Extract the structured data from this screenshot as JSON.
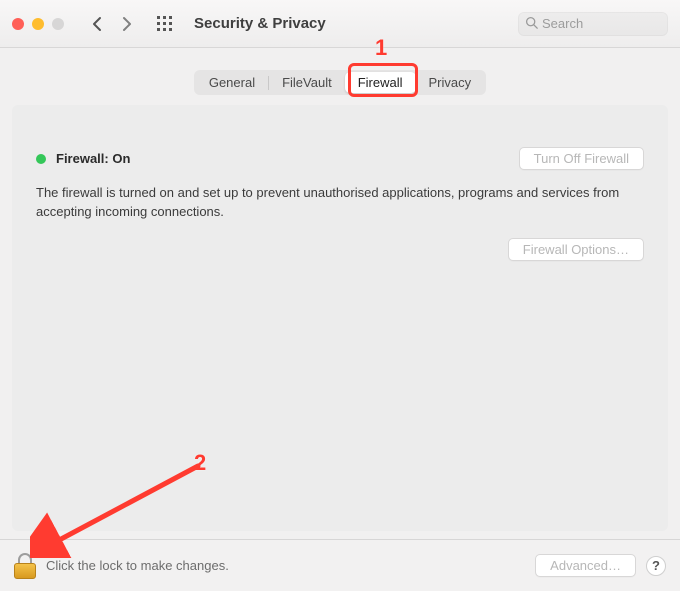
{
  "header": {
    "title": "Security & Privacy",
    "search_placeholder": "Search"
  },
  "tabs": [
    {
      "label": "General"
    },
    {
      "label": "FileVault"
    },
    {
      "label": "Firewall"
    },
    {
      "label": "Privacy"
    }
  ],
  "firewall": {
    "status_label": "Firewall: On",
    "turn_off_label": "Turn Off Firewall",
    "description": "The firewall is turned on and set up to prevent unauthorised applications, programs and services from accepting incoming connections.",
    "options_label": "Firewall Options…"
  },
  "bottom": {
    "lock_text": "Click the lock to make changes.",
    "advanced_label": "Advanced…",
    "help_label": "?"
  },
  "annotations": {
    "num1": "1",
    "num2": "2"
  },
  "colors": {
    "accent_red": "#ff3b30",
    "status_green": "#34c759"
  }
}
